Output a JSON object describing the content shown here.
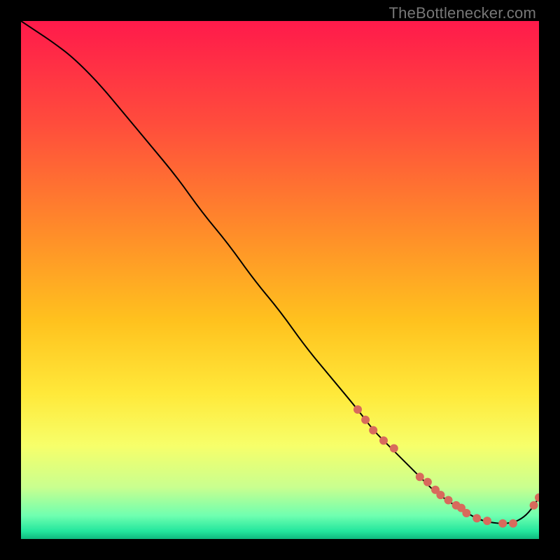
{
  "watermark": "TheBottlenecker.com",
  "chart_data": {
    "type": "line",
    "title": "",
    "xlabel": "",
    "ylabel": "",
    "xlim": [
      0,
      100
    ],
    "ylim": [
      0,
      100
    ],
    "grid": false,
    "gradient_stops": [
      {
        "offset": 0,
        "color": "#ff1a4b"
      },
      {
        "offset": 0.2,
        "color": "#ff4d3c"
      },
      {
        "offset": 0.4,
        "color": "#ff8a2a"
      },
      {
        "offset": 0.58,
        "color": "#ffc21e"
      },
      {
        "offset": 0.72,
        "color": "#ffe93a"
      },
      {
        "offset": 0.82,
        "color": "#f7ff6a"
      },
      {
        "offset": 0.9,
        "color": "#c9ff8f"
      },
      {
        "offset": 0.955,
        "color": "#6fffb0"
      },
      {
        "offset": 0.985,
        "color": "#23e69d"
      },
      {
        "offset": 1.0,
        "color": "#0fb97e"
      }
    ],
    "series": [
      {
        "name": "bottleneck-curve",
        "color": "#000000",
        "stroke_width": 2,
        "x": [
          0,
          3,
          6,
          10,
          15,
          20,
          25,
          30,
          35,
          40,
          45,
          50,
          55,
          60,
          65,
          68,
          71,
          74,
          77,
          80,
          83,
          86,
          89,
          92,
          94,
          96,
          98,
          100
        ],
        "y": [
          100,
          98,
          96,
          93,
          88,
          82,
          76,
          70,
          63,
          57,
          50,
          44,
          37,
          31,
          25,
          21,
          18,
          15,
          12,
          9,
          7,
          5,
          3.5,
          3,
          3,
          3.5,
          5,
          8
        ]
      }
    ],
    "markers": {
      "name": "highlighted-range",
      "color": "#d86a5c",
      "radius": 6,
      "x": [
        65,
        66.5,
        68,
        70,
        72,
        77,
        78.5,
        80,
        81,
        82.5,
        84,
        85,
        86,
        88,
        90,
        93,
        95,
        99,
        100
      ],
      "y": [
        25,
        23,
        21,
        19,
        17.5,
        12,
        11,
        9.5,
        8.5,
        7.5,
        6.5,
        6,
        5,
        4,
        3.5,
        3,
        3,
        6.5,
        8
      ]
    }
  }
}
